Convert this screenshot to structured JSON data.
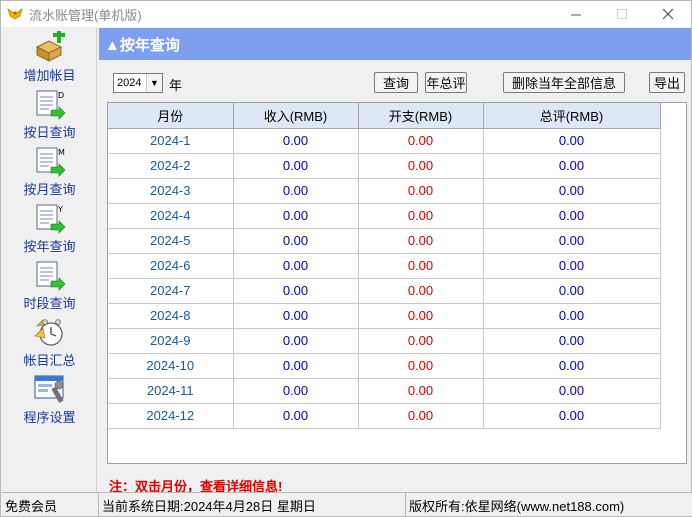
{
  "window": {
    "title": "流水账管理(单机版)"
  },
  "sidebar": {
    "items": [
      {
        "label": "增加帐目",
        "icon": "add-entry-icon"
      },
      {
        "label": "按日查询",
        "icon": "daily-report-icon"
      },
      {
        "label": "按月查询",
        "icon": "monthly-report-icon"
      },
      {
        "label": "按年查询",
        "icon": "yearly-report-icon"
      },
      {
        "label": "时段查询",
        "icon": "period-report-icon"
      },
      {
        "label": "帐目汇总",
        "icon": "alarm-clock-icon"
      },
      {
        "label": "程序设置",
        "icon": "settings-window-icon"
      }
    ]
  },
  "main": {
    "header": "▲按年查询",
    "year_select": "2024",
    "year_unit": "年",
    "buttons": {
      "query": "查询",
      "year_summary": "年总评",
      "delete_all": "删除当年全部信息",
      "export": "导出"
    },
    "table": {
      "columns": [
        "月份",
        "收入(RMB)",
        "开支(RMB)",
        "总评(RMB)"
      ],
      "rows": [
        [
          "2024-1",
          "0.00",
          "0.00",
          "0.00"
        ],
        [
          "2024-2",
          "0.00",
          "0.00",
          "0.00"
        ],
        [
          "2024-3",
          "0.00",
          "0.00",
          "0.00"
        ],
        [
          "2024-4",
          "0.00",
          "0.00",
          "0.00"
        ],
        [
          "2024-5",
          "0.00",
          "0.00",
          "0.00"
        ],
        [
          "2024-6",
          "0.00",
          "0.00",
          "0.00"
        ],
        [
          "2024-7",
          "0.00",
          "0.00",
          "0.00"
        ],
        [
          "2024-8",
          "0.00",
          "0.00",
          "0.00"
        ],
        [
          "2024-9",
          "0.00",
          "0.00",
          "0.00"
        ],
        [
          "2024-10",
          "0.00",
          "0.00",
          "0.00"
        ],
        [
          "2024-11",
          "0.00",
          "0.00",
          "0.00"
        ],
        [
          "2024-12",
          "0.00",
          "0.00",
          "0.00"
        ]
      ]
    },
    "note": "注：双击月份，查看详细信息!"
  },
  "statusbar": {
    "member": "免费会员",
    "date": "当前系统日期:2024年4月28日 星期日",
    "copyright": "版权所有:依星网络(www.net188.com)"
  },
  "colors": {
    "header_bg": "#7e9ef0",
    "income": "#0000cc",
    "expense": "#dd0000",
    "month": "#1a5a9a",
    "column_header_bg": "#dde7f5"
  }
}
